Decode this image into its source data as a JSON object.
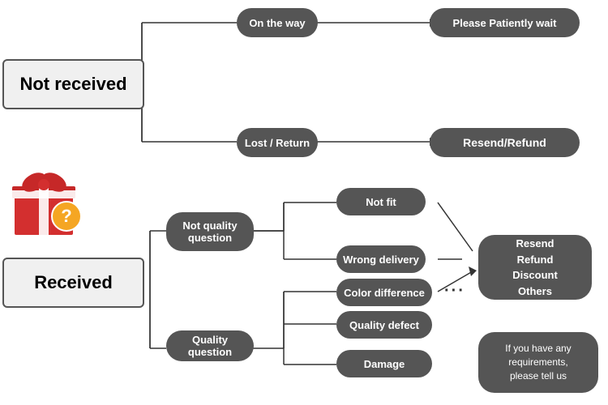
{
  "nodes": {
    "not_received": {
      "label": "Not received"
    },
    "on_the_way": {
      "label": "On the way"
    },
    "please_wait": {
      "label": "Please Patiently wait"
    },
    "lost_return": {
      "label": "Lost / Return"
    },
    "resend_refund": {
      "label": "Resend/Refund"
    },
    "received": {
      "label": "Received"
    },
    "not_quality": {
      "label": "Not quality\nquestion"
    },
    "not_fit": {
      "label": "Not fit"
    },
    "wrong_delivery": {
      "label": "Wrong delivery"
    },
    "quality_question": {
      "label": "Quality question"
    },
    "color_diff": {
      "label": "Color difference"
    },
    "quality_defect": {
      "label": "Quality defect"
    },
    "damage": {
      "label": "Damage"
    },
    "resend_options": {
      "label": "Resend\nRefund\nDiscount\nOthers"
    },
    "if_requirements": {
      "label": "If you have any\nrequirements,\nplease tell us"
    }
  }
}
